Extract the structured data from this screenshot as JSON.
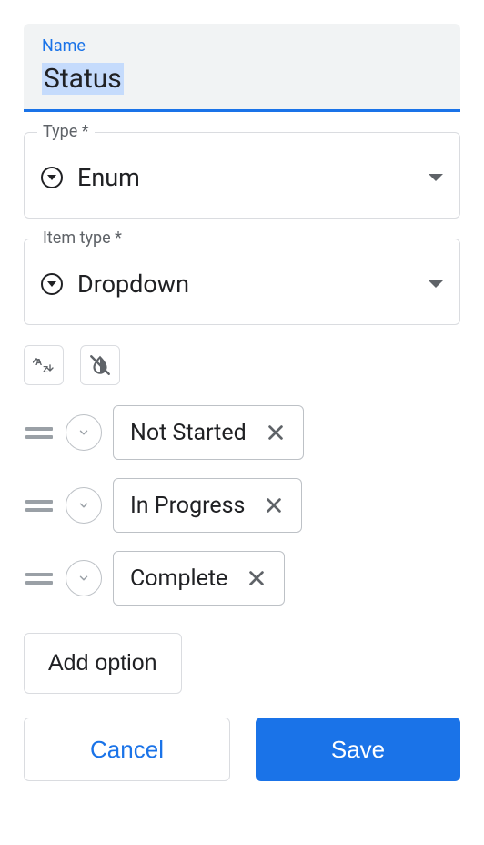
{
  "name_field": {
    "label": "Name",
    "value": "Status"
  },
  "type_field": {
    "label": "Type *",
    "value": "Enum"
  },
  "item_type_field": {
    "label": "Item type *",
    "value": "Dropdown"
  },
  "options": [
    {
      "label": "Not Started"
    },
    {
      "label": "In Progress"
    },
    {
      "label": "Complete"
    }
  ],
  "buttons": {
    "add_option": "Add option",
    "cancel": "Cancel",
    "save": "Save"
  }
}
